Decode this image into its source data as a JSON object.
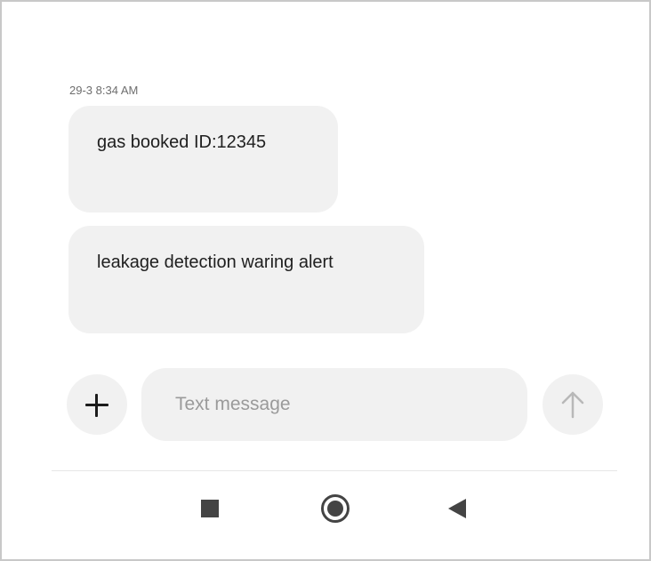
{
  "conversation": {
    "timestamp": "29-3 8:34 AM",
    "messages": [
      {
        "text": "gas booked ID:12345"
      },
      {
        "text": "leakage detection waring alert"
      }
    ]
  },
  "composer": {
    "placeholder": "Text message",
    "value": "",
    "attach_icon": "plus-icon",
    "send_icon": "arrow-up-icon"
  },
  "navigation_bar": {
    "icons": [
      "recents-square-icon",
      "home-circle-icon",
      "back-triangle-icon"
    ]
  },
  "colors": {
    "bubble_background": "#f1f1f1",
    "text": "#202020",
    "placeholder": "#9a9a9a",
    "nav_icon": "#444444"
  }
}
